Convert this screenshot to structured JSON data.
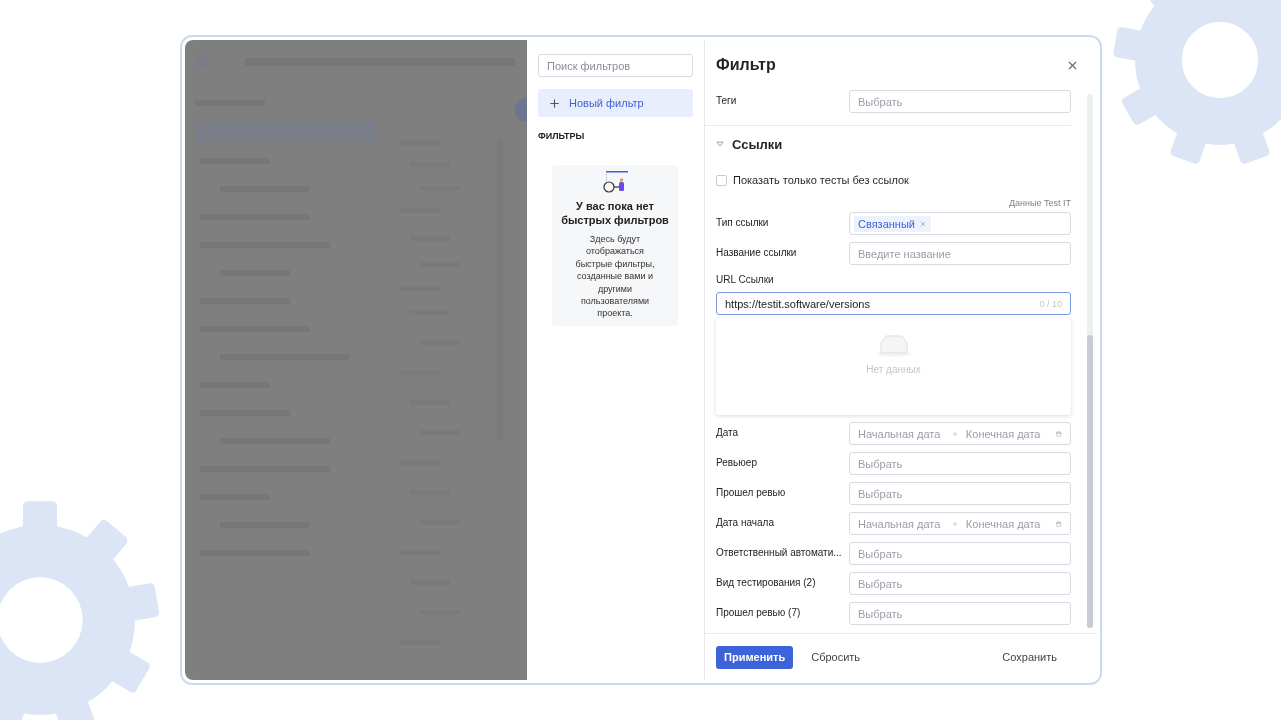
{
  "sidebar": {
    "search_placeholder": "Поиск фильтров",
    "new_filter": "Новый фильтр",
    "section_title": "ФИЛЬТРЫ",
    "empty": {
      "title": "У вас пока нет быстрых фильтров",
      "text": "Здесь будут отображаться быстрые фильтры, созданные вами и другими пользователями проекта."
    }
  },
  "panel": {
    "title": "Фильтр",
    "top_fields": [
      {
        "label": "Теги",
        "kind": "select",
        "placeholder": "Выбрать"
      }
    ],
    "section": {
      "title": "Ссылки",
      "expanded": true,
      "checkbox": {
        "label": "Показать только тесты без ссылок",
        "checked": false
      },
      "source_note": "Данные Test IT",
      "fields": [
        {
          "label": "Тип ссылки",
          "kind": "tags",
          "tags": [
            "Связанный"
          ]
        },
        {
          "label": "Название ссылки",
          "kind": "text",
          "placeholder": "Введите название"
        }
      ],
      "url": {
        "label": "URL Ссылки",
        "value": "https://testit.software/versions",
        "counter": "0 / 10"
      },
      "dropdown": {
        "empty_text": "Нет данных"
      }
    },
    "fields": [
      {
        "label": "Дата",
        "kind": "date_range",
        "start_placeholder": "Начальная дата",
        "end_placeholder": "Конечная дата"
      },
      {
        "label": "Ревьюер",
        "kind": "select",
        "placeholder": "Выбрать"
      },
      {
        "label": "Прошел ревью",
        "kind": "select",
        "placeholder": "Выбрать"
      },
      {
        "label": "Дата начала",
        "kind": "date_range",
        "start_placeholder": "Начальная дата",
        "end_placeholder": "Конечная дата"
      },
      {
        "label": "Ответственный автомати...",
        "kind": "select",
        "placeholder": "Выбрать"
      },
      {
        "label": "Вид тестирования (2)",
        "kind": "select",
        "placeholder": "Выбрать"
      },
      {
        "label": "Прошел ревью (7)",
        "kind": "select",
        "placeholder": "Выбрать"
      }
    ],
    "footer": {
      "apply": "Применить",
      "reset": "Сбросить",
      "save": "Сохранить"
    }
  }
}
